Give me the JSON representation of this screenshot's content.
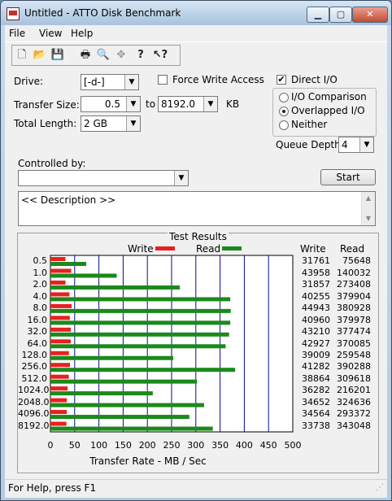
{
  "window": {
    "title": "Untitled - ATTO Disk Benchmark"
  },
  "menu": {
    "items": [
      "File",
      "View",
      "Help"
    ]
  },
  "toolbar": {
    "icons": [
      "new-icon",
      "open-icon",
      "save-icon",
      "print-icon",
      "print-preview-icon",
      "move-icon",
      "help-icon",
      "context-help-icon"
    ]
  },
  "settings": {
    "drive_label": "Drive:",
    "drive_value": "[-d-]",
    "transfer_label": "Transfer Size:",
    "transfer_from": "0.5",
    "transfer_to_label": "to",
    "transfer_to": "8192.0",
    "transfer_unit": "KB",
    "length_label": "Total Length:",
    "length_value": "2 GB",
    "force_write_label": "Force Write Access",
    "force_write_checked": false,
    "direct_io_label": "Direct I/O",
    "direct_io_checked": true,
    "io_comparison_label": "I/O Comparison",
    "overlapped_label": "Overlapped I/O",
    "neither_label": "Neither",
    "selected_mode": "Overlapped I/O",
    "queue_label": "Queue Depth:",
    "queue_value": "4",
    "controlled_label": "Controlled by:",
    "controlled_value": "",
    "start_label": "Start",
    "description": "<< Description >>"
  },
  "colors": {
    "write": "#e82020",
    "read": "#1a8a1a",
    "grid": "#0a0a8c"
  },
  "chart_data": {
    "type": "bar",
    "title": "Test Results",
    "orientation": "horizontal",
    "categories": [
      "0.5",
      "1.0",
      "2.0",
      "4.0",
      "8.0",
      "16.0",
      "32.0",
      "64.0",
      "128.0",
      "256.0",
      "512.0",
      "1024.0",
      "2048.0",
      "4096.0",
      "8192.0"
    ],
    "series": [
      {
        "name": "Write",
        "values": [
          31761,
          43958,
          31857,
          40255,
          44943,
          40960,
          43210,
          42927,
          39009,
          41282,
          38864,
          36282,
          34652,
          34564,
          33738
        ]
      },
      {
        "name": "Read",
        "values": [
          75648,
          140032,
          273408,
          379904,
          380928,
          379978,
          377474,
          370085,
          259548,
          390288,
          309618,
          216201,
          324636,
          293372,
          343048
        ]
      }
    ],
    "xlabel": "Transfer Rate - MB / Sec",
    "xlim": [
      0,
      500
    ],
    "xticks": [
      "0",
      "50",
      "100",
      "150",
      "200",
      "250",
      "300",
      "350",
      "400",
      "450",
      "500"
    ],
    "column_headers": [
      "Write",
      "Read"
    ],
    "legend_position": "top"
  },
  "status": {
    "text": "For Help, press F1"
  }
}
